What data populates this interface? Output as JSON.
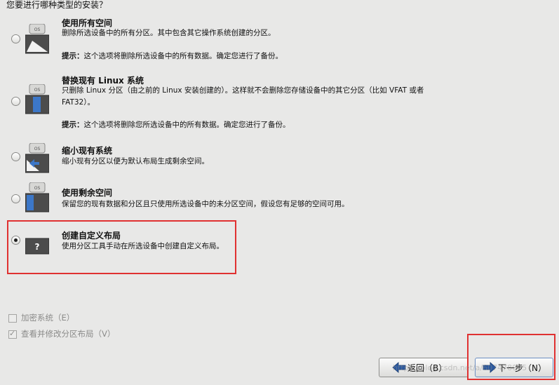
{
  "question": "您要进行哪种类型的安装？",
  "options": [
    {
      "title": "使用所有空间",
      "desc": "删除所选设备中的所有分区。其中包含其它操作系统创建的分区。",
      "tip_label": "提示：",
      "tip_text": "这个选项将删除所选设备中的所有数据。确定您进行了备份。",
      "icon_label": "OS",
      "checked": false
    },
    {
      "title": "替换现有 Linux 系统",
      "desc": "只删除 Linux 分区（由之前的 Linux 安装创建的）。这样就不会删除您存储设备中的其它分区（比如 VFAT 或者 FAT32）。",
      "tip_label": "提示：",
      "tip_text": "这个选项将删除您所选设备中的所有数据。确定您进行了备份。",
      "icon_label": "OS",
      "checked": false
    },
    {
      "title": "缩小现有系统",
      "desc": "缩小现有分区以便为默认布局生成剩余空间。",
      "icon_label": "OS",
      "checked": false
    },
    {
      "title": "使用剩余空间",
      "desc": "保留您的现有数据和分区且只使用所选设备中的未分区空间，假设您有足够的空间可用。",
      "icon_label": "OS",
      "checked": false
    },
    {
      "title": "创建自定义布局",
      "desc": "使用分区工具手动在所选设备中创建自定义布局。",
      "icon_label": "?",
      "checked": true
    }
  ],
  "checkboxes": [
    {
      "label": "加密系统（E）",
      "checked": false
    },
    {
      "label": "查看并修改分区布局（V）",
      "checked": true
    }
  ],
  "buttons": {
    "back": "返回（B）",
    "next": "下一步（N）"
  },
  "watermark": "https://blog.csdn.net/a/607478095",
  "colors": {
    "background": "#e8e8e7",
    "highlight": "#e03131",
    "arrow": "#2c5aa0"
  }
}
